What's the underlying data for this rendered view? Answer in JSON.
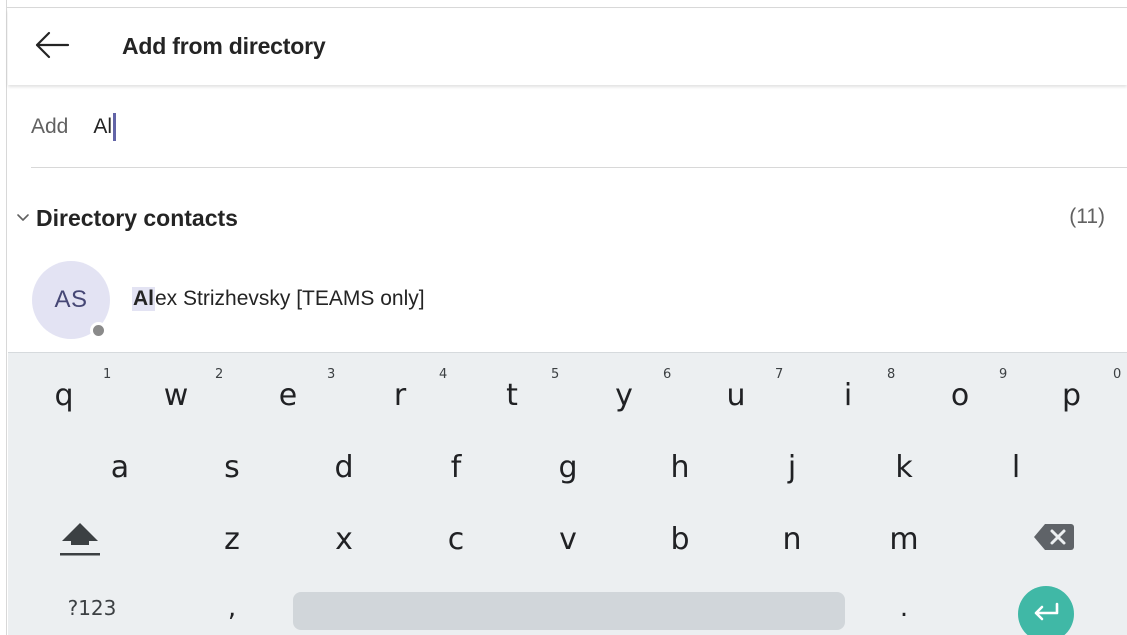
{
  "header": {
    "title": "Add from directory",
    "back_icon": "arrow-left-icon"
  },
  "add_field": {
    "label": "Add",
    "value": "Al"
  },
  "section": {
    "title": "Directory contacts",
    "count": "(11)",
    "collapse_icon": "chevron-down-icon"
  },
  "contacts": [
    {
      "initials": "AS",
      "name_match": "Al",
      "name_rest": "ex Strizhevsky [TEAMS only]",
      "presence": "offline"
    }
  ],
  "keyboard": {
    "row1": [
      {
        "key": "q",
        "hint": "1"
      },
      {
        "key": "w",
        "hint": "2"
      },
      {
        "key": "e",
        "hint": "3"
      },
      {
        "key": "r",
        "hint": "4"
      },
      {
        "key": "t",
        "hint": "5"
      },
      {
        "key": "y",
        "hint": "6"
      },
      {
        "key": "u",
        "hint": "7"
      },
      {
        "key": "i",
        "hint": "8"
      },
      {
        "key": "o",
        "hint": "9"
      },
      {
        "key": "p",
        "hint": "0"
      }
    ],
    "row2": [
      "a",
      "s",
      "d",
      "f",
      "g",
      "h",
      "j",
      "k",
      "l"
    ],
    "row3": [
      "z",
      "x",
      "c",
      "v",
      "b",
      "n",
      "m"
    ],
    "symbols_label": "?123",
    "comma": ",",
    "period": ".",
    "shift_icon": "shift-icon",
    "backspace_icon": "backspace-icon",
    "enter_icon": "enter-icon"
  },
  "colors": {
    "accent": "#6264a7",
    "avatar_bg": "#e3e3f3",
    "avatar_text": "#464775",
    "enter_key": "#40b8a6",
    "keyboard_bg": "#eceff1"
  }
}
